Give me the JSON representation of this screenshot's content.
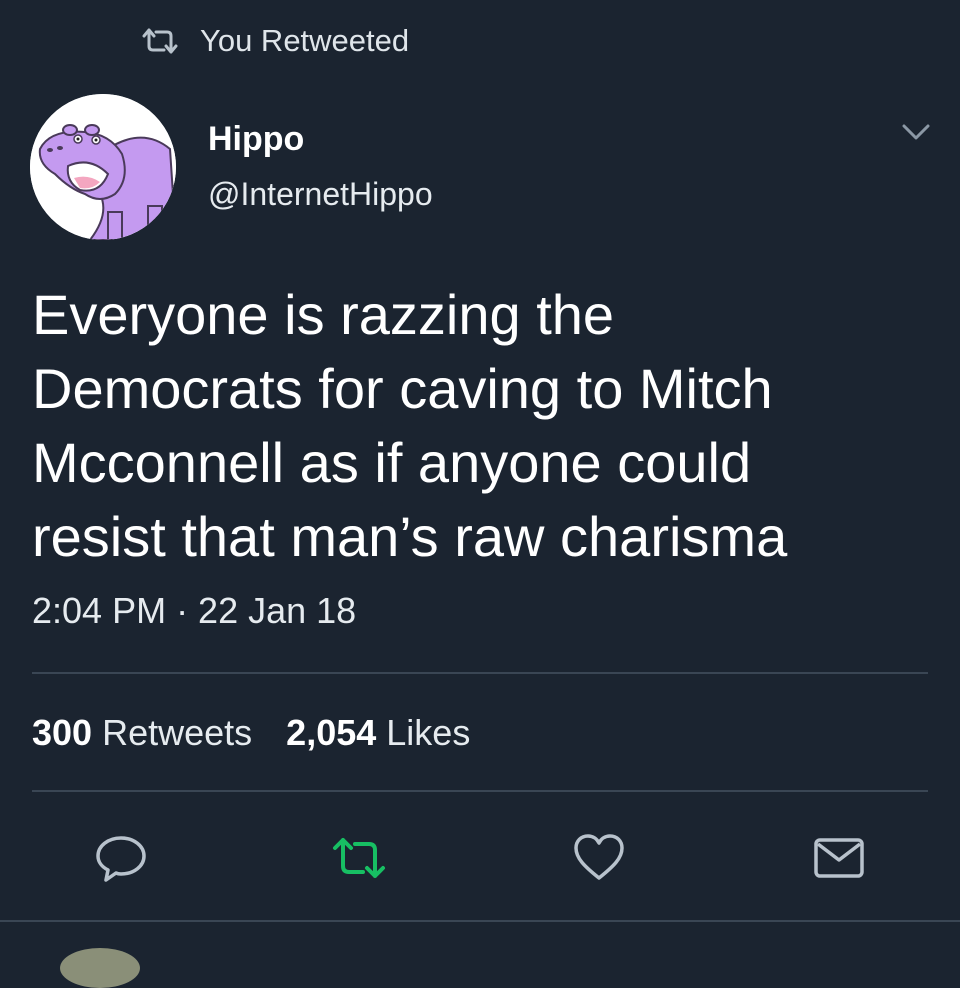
{
  "retweet_banner": {
    "icon": "retweet-icon",
    "label": "You Retweeted"
  },
  "author": {
    "avatar": "hippo-avatar",
    "name": "Hippo",
    "handle": "@InternetHippo"
  },
  "menu_icon": "chevron-down-icon",
  "tweet": {
    "lines": [
      "Everyone is razzing the",
      "Democrats for caving to Mitch",
      "Mcconnell as if anyone could",
      "resist that man’s raw charisma"
    ],
    "timestamp": "2:04 PM · 22 Jan 18"
  },
  "stats": {
    "retweets_count": "300",
    "retweets_label": "Retweets",
    "likes_count": "2,054",
    "likes_label": "Likes"
  },
  "actions": [
    {
      "icon": "reply-icon"
    },
    {
      "icon": "retweet-icon",
      "active": true
    },
    {
      "icon": "heart-icon"
    },
    {
      "icon": "mail-icon"
    }
  ],
  "colors": {
    "background": "#1b2430",
    "divider": "#3a4654",
    "icon": "#b8c2cc",
    "retweet_active": "#17bf63",
    "hippo": "#c49af0"
  }
}
